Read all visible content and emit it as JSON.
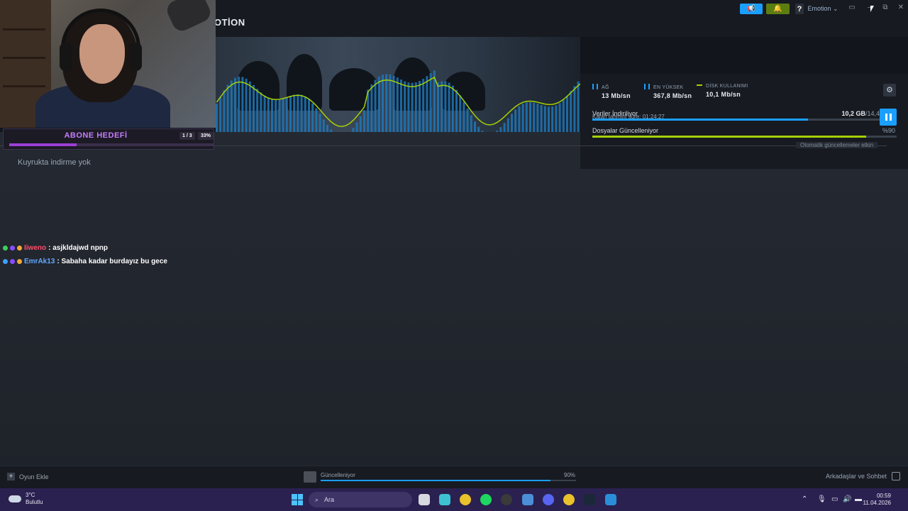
{
  "app": {
    "title": "OTİON",
    "user_menu": "Emotion ⌄",
    "help": "?"
  },
  "stats": {
    "network": {
      "label": "AĞ",
      "value": "13 Mb/sn"
    },
    "peak": {
      "label": "EN YÜKSEK",
      "value": "367,8 Mb/sn"
    },
    "disk": {
      "label": "DİSK KULLANIMI",
      "value": "10,1 Mb/sn"
    }
  },
  "download": {
    "row1_label": "Veriler İndiriliyor",
    "row1_done": "10,2 GB",
    "row1_total": "/14,4 GB",
    "row1_progress": 0.708,
    "row2_label": "Dosyalar Güncelleniyor",
    "row2_pct": "%90",
    "row2_progress": 0.9,
    "eta": "Kalan tahmini süre: 01:24:27"
  },
  "queue": {
    "auto_updates": "Otomatik güncellemeler etkin",
    "empty": "Kuyrukta indirme yok"
  },
  "overlay": {
    "goal_title": "ABONE HEDEFİ",
    "goal_count": "1 / 3",
    "goal_pct": "33%",
    "goal_progress": 0.33
  },
  "chat": [
    {
      "user": "Iiweno",
      "color": "#ff4d6d",
      "text": ": asjkldajwd npnp"
    },
    {
      "user": "EmrAk13",
      "color": "#5fa8ff",
      "text": ": Sabaha kadar burdayız bu gece"
    }
  ],
  "footer": {
    "add_game": "Oyun Ekle",
    "dl_label": "Güncelleniyor",
    "dl_pct": "90%",
    "dl_progress": 0.9,
    "friends": "Arkadaşlar ve Sohbet"
  },
  "taskbar": {
    "temp": "3°C",
    "weather": "Bulutlu",
    "search": "Ara",
    "time": "00:59",
    "date": "11.04.2026"
  },
  "colors": {
    "accent": "#1a9fff",
    "green": "#5c7e10",
    "line": "#a4d007"
  }
}
